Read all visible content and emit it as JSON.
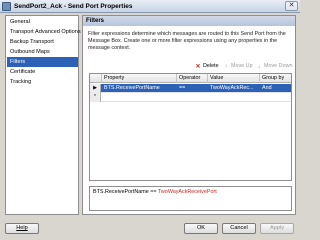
{
  "window": {
    "title": "SendPort2_Ack - Send Port Properties",
    "close_glyph": "✕"
  },
  "nav": {
    "items": [
      {
        "label": "General",
        "selected": false
      },
      {
        "label": "Transport Advanced Options",
        "selected": false
      },
      {
        "label": "Backup Transport",
        "selected": false
      },
      {
        "label": "Outbound Maps",
        "selected": false
      },
      {
        "label": "Filters",
        "selected": true
      },
      {
        "label": "Certificate",
        "selected": false
      },
      {
        "label": "Tracking",
        "selected": false
      }
    ]
  },
  "panel": {
    "header": "Filters",
    "description": "Filter expressions determine which messages are routed to this Send Port from the Message Box. Create one or more filter expressions using any properties in the message context."
  },
  "toolbar": {
    "delete_label": "Delete",
    "move_up_label": "Move Up",
    "move_down_label": "Move Down",
    "delete_icon": "delete-icon",
    "move_up_icon": "move-up-icon",
    "move_down_icon": "move-down-icon"
  },
  "grid": {
    "columns": [
      "Property",
      "Operator",
      "Value",
      "Group by"
    ],
    "rows": [
      {
        "marker": "▶",
        "property": "BTS.ReceivePortName",
        "operator": "==",
        "value": "TwoWayAckRec...",
        "group_by": "And",
        "selected": true
      },
      {
        "marker": "*",
        "property": "",
        "operator": "",
        "value": "",
        "group_by": "",
        "selected": false
      }
    ]
  },
  "expression": {
    "property": "BTS.ReceivePortName",
    "operator": "==",
    "value": "TwoWayAckReceivePort"
  },
  "buttons": {
    "help": "Help",
    "ok": "OK",
    "cancel": "Cancel",
    "apply": "Apply"
  },
  "colors": {
    "selection": "#2d61b5",
    "expression_value": "#c62828",
    "delete_icon": "#c62828"
  }
}
